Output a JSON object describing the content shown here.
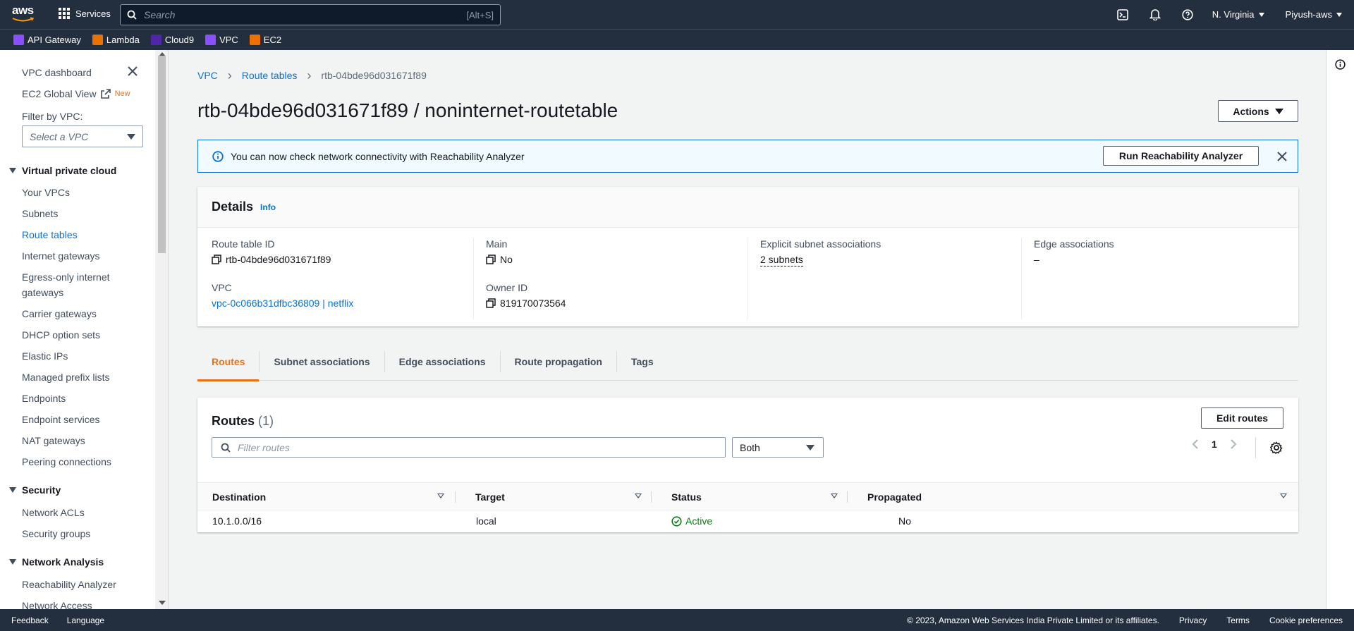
{
  "top": {
    "logo": "aws",
    "services_label": "Services",
    "search_placeholder": "Search",
    "search_hint": "[Alt+S]",
    "region": "N. Virginia",
    "user": "Piyush-aws"
  },
  "favorites": [
    {
      "label": "API Gateway",
      "color": "#8c4fff",
      "icon": "api-gateway-icon"
    },
    {
      "label": "Lambda",
      "color": "#ed7100",
      "icon": "lambda-icon"
    },
    {
      "label": "Cloud9",
      "color": "#4d27a8",
      "icon": "cloud9-icon"
    },
    {
      "label": "VPC",
      "color": "#8c4fff",
      "icon": "vpc-icon"
    },
    {
      "label": "EC2",
      "color": "#ed7100",
      "icon": "ec2-icon"
    }
  ],
  "sidebar": {
    "dashboard": "VPC dashboard",
    "global_view": "EC2 Global View",
    "new_badge": "New",
    "filter_label": "Filter by VPC:",
    "filter_placeholder": "Select a VPC",
    "sections": [
      {
        "title": "Virtual private cloud"
      },
      {
        "title": "Security"
      },
      {
        "title": "Network Analysis"
      }
    ],
    "items": [
      "Your VPCs",
      "Subnets",
      "Route tables",
      "Internet gateways",
      "Egress-only internet",
      "gateways",
      "Carrier gateways",
      "DHCP option sets",
      "Elastic IPs",
      "Managed prefix lists",
      "Endpoints",
      "Endpoint services",
      "NAT gateways",
      "Peering connections",
      "Network ACLs",
      "Security groups",
      "Reachability Analyzer",
      "Network Access"
    ]
  },
  "breadcrumb": {
    "vpc": "VPC",
    "route_tables": "Route tables",
    "current": "rtb-04bde96d031671f89"
  },
  "page_title": "rtb-04bde96d031671f89 / noninternet-routetable",
  "actions_label": "Actions",
  "flash": {
    "text": "You can now check network connectivity with Reachability Analyzer",
    "button": "Run Reachability Analyzer"
  },
  "details": {
    "title": "Details",
    "info": "Info",
    "route_table_id_label": "Route table ID",
    "route_table_id": "rtb-04bde96d031671f89",
    "main_label": "Main",
    "main": "No",
    "explicit_label": "Explicit subnet associations",
    "explicit": "2 subnets",
    "edge_label": "Edge associations",
    "edge": "–",
    "vpc_label": "VPC",
    "vpc": "vpc-0c066b31dfbc36809 | netflix",
    "owner_label": "Owner ID",
    "owner": "819170073564"
  },
  "tabs": [
    "Routes",
    "Subnet associations",
    "Edge associations",
    "Route propagation",
    "Tags"
  ],
  "routes": {
    "title": "Routes",
    "count": "(1)",
    "edit": "Edit routes",
    "filter_placeholder": "Filter routes",
    "select": "Both",
    "page": "1",
    "columns": [
      "Destination",
      "Target",
      "Status",
      "Propagated"
    ],
    "rows": [
      {
        "destination": "10.1.0.0/16",
        "target": "local",
        "status": "Active",
        "propagated": "No"
      }
    ]
  },
  "footer": {
    "feedback": "Feedback",
    "language": "Language",
    "copyright": "© 2023, Amazon Web Services India Private Limited or its affiliates.",
    "privacy": "Privacy",
    "terms": "Terms",
    "cookies": "Cookie preferences"
  }
}
